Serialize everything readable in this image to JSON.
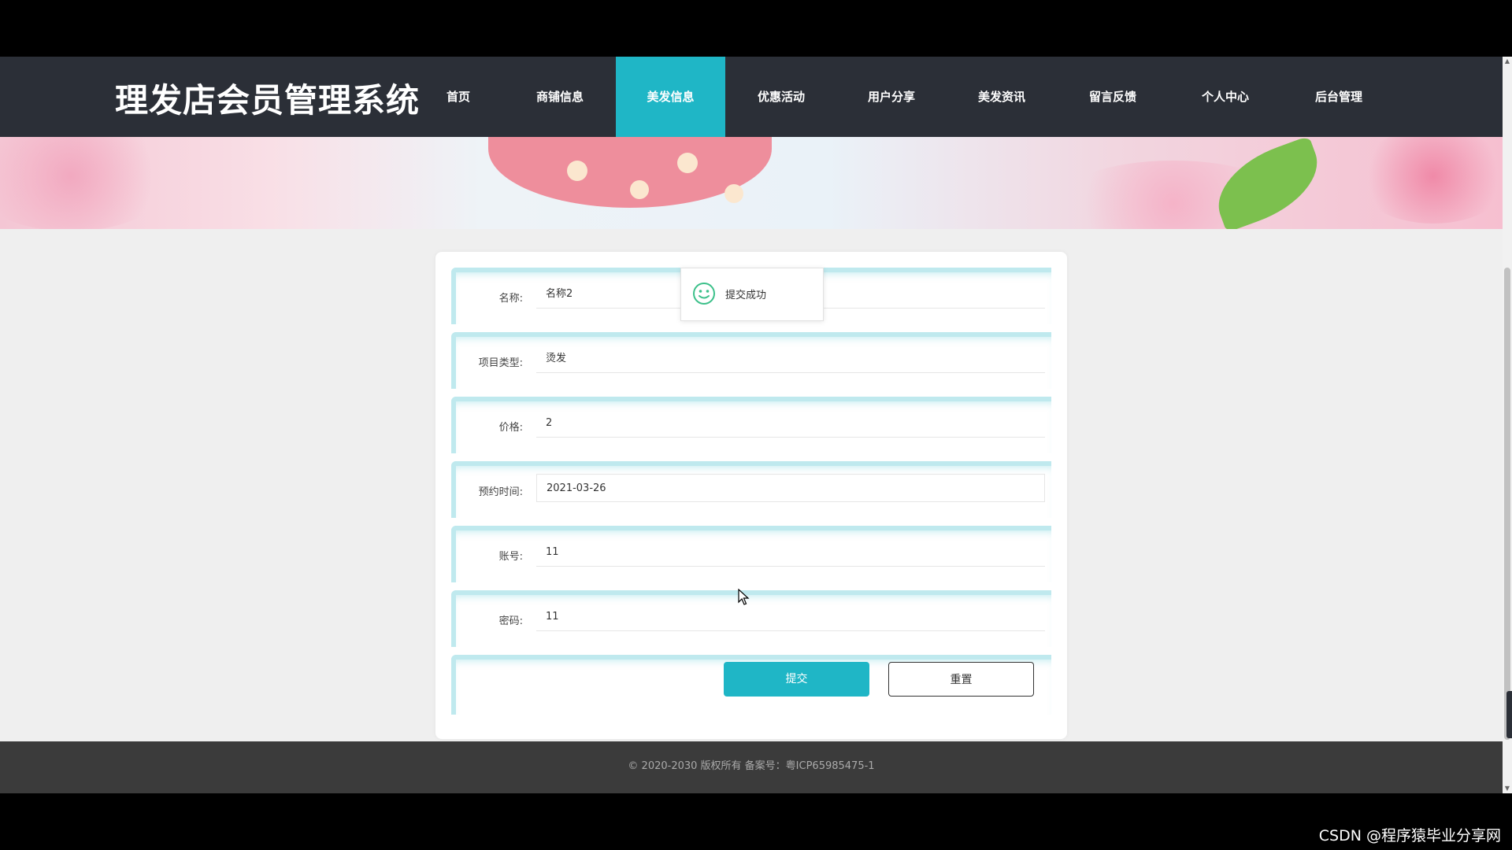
{
  "brand": "理发店会员管理系统",
  "nav": {
    "items": [
      {
        "label": "首页"
      },
      {
        "label": "商铺信息"
      },
      {
        "label": "美发信息",
        "active": true
      },
      {
        "label": "优惠活动"
      },
      {
        "label": "用户分享"
      },
      {
        "label": "美发资讯"
      },
      {
        "label": "留言反馈"
      },
      {
        "label": "个人中心"
      },
      {
        "label": "后台管理"
      }
    ]
  },
  "form": {
    "fields": [
      {
        "label": "名称:",
        "value": "名称2"
      },
      {
        "label": "项目类型:",
        "value": "烫发"
      },
      {
        "label": "价格:",
        "value": "2"
      },
      {
        "label": "预约时间:",
        "value": "2021-03-26"
      },
      {
        "label": "账号:",
        "value": "11"
      },
      {
        "label": "密码:",
        "value": "11"
      }
    ],
    "submit_label": "提交",
    "reset_label": "重置"
  },
  "toast": {
    "text": "提交成功",
    "icon": "smile-icon"
  },
  "footer": {
    "text": "© 2020-2030 版权所有 备案号：粤ICP65985475-1"
  },
  "watermark": "CSDN @程序猿毕业分享网",
  "colors": {
    "accent": "#1fb6c6",
    "nav_bg": "#2b2f37",
    "footer_bg": "#3b3b3b"
  }
}
